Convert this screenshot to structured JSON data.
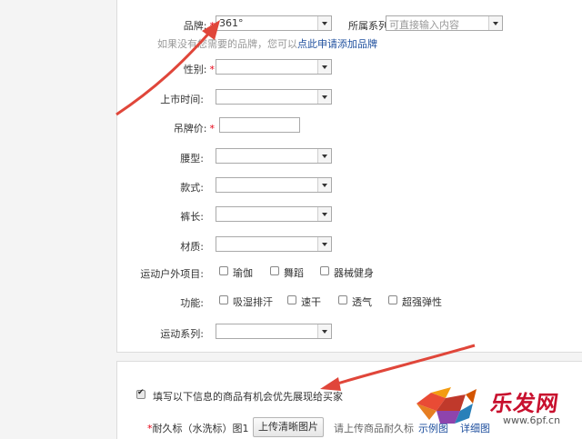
{
  "form": {
    "brand": {
      "label": "品牌:",
      "required_mark": "*",
      "value": "361°"
    },
    "series": {
      "label": "所属系列",
      "placeholder": "可直接输入内容"
    },
    "brand_hint": {
      "prefix": "如果没有您需要的品牌，您可以",
      "link": "点此申请添加品牌"
    },
    "gender": {
      "label": "性别:",
      "required_mark": "*",
      "value": ""
    },
    "launch_time": {
      "label": "上市时间:",
      "value": ""
    },
    "tag_price": {
      "label": "吊牌价:",
      "required_mark": "*",
      "value": ""
    },
    "waist": {
      "label": "腰型:",
      "value": ""
    },
    "style": {
      "label": "款式:",
      "value": ""
    },
    "length": {
      "label": "裤长:",
      "value": ""
    },
    "material": {
      "label": "材质:",
      "value": ""
    },
    "outdoor": {
      "label": "运动户外项目:",
      "options": [
        "瑜伽",
        "舞蹈",
        "器械健身"
      ]
    },
    "function": {
      "label": "功能:",
      "options": [
        "吸湿排汗",
        "速干",
        "透气",
        "超强弹性"
      ]
    },
    "sport_series": {
      "label": "运动系列:",
      "value": ""
    }
  },
  "section2": {
    "checkbox_label": "填写以下信息的商品有机会优先展现给买家",
    "checked": true,
    "care_label": {
      "required_mark": "*",
      "label": "耐久标（水洗标）图1"
    },
    "upload_button": "上传清晰图片",
    "upload_hint": "请上传商品耐久标",
    "link1": "示例图",
    "link2": "详细图"
  },
  "watermark": {
    "text": "乐发网",
    "url": "www.6pf.cn"
  },
  "colors": {
    "required": "#e60012",
    "link": "#1e4f9e",
    "arrow": "#e0463a"
  }
}
